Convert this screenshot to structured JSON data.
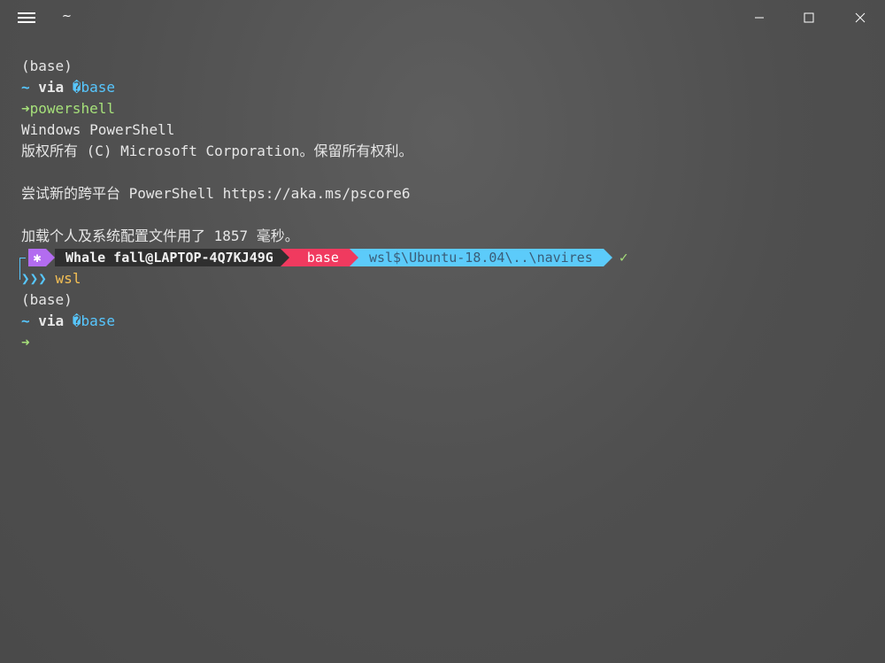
{
  "window": {
    "tab_title": "~",
    "menu_icon": "hamburger-menu-icon",
    "minimize_icon": "minimize-icon",
    "maximize_icon": "maximize-icon",
    "close_icon": "close-icon"
  },
  "terminal": {
    "lines": {
      "l1": "(base)",
      "l2_tilde": "~",
      "l2_via": "via",
      "l2_glyph": "�",
      "l2_env": "base",
      "l3_arrow": "➜",
      "l3_cmd": "powershell",
      "l4": "Windows PowerShell",
      "l5": "版权所有 (C) Microsoft Corporation。保留所有权利。",
      "l6": "",
      "l7": "尝试新的跨平台 PowerShell https://aka.ms/pscore6",
      "l8": "",
      "l9": "加载个人及系统配置文件用了 1857 毫秒。",
      "l11_chevrons": "❯❯❯",
      "l11_cmd": "wsl",
      "l12": "(base)",
      "l13_tilde": "~",
      "l13_via": "via",
      "l13_glyph": "�",
      "l13_env": "base",
      "l14_arrow": "➜"
    },
    "prompt": {
      "icon_glyph": "✱",
      "user_host": "Whale fall@LAPTOP-4Q7KJ49G",
      "env": "base",
      "path": "wsl$\\Ubuntu-18.04\\..\\navires",
      "status": "✓"
    },
    "colors": {
      "icon_segment": "#b36cf0",
      "user_segment": "#2f2f2f",
      "env_segment": "#f03a5f",
      "path_segment": "#5ccbfa",
      "cyan": "#57c7ff",
      "green": "#a6e07a",
      "yellow": "#f5c054"
    }
  }
}
